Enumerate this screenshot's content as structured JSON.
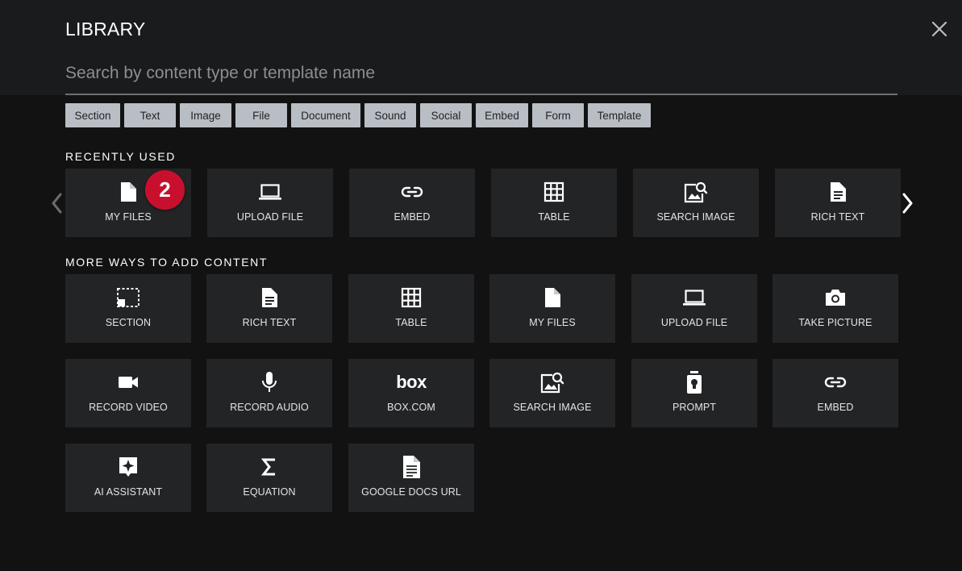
{
  "title": "LIBRARY",
  "search": {
    "placeholder": "Search by content type or template name"
  },
  "filters": [
    "Section",
    "Text",
    "Image",
    "File",
    "Document",
    "Sound",
    "Social",
    "Embed",
    "Form",
    "Template"
  ],
  "recently_used": {
    "label": "RECENTLY USED",
    "items": [
      {
        "label": "MY FILES",
        "icon": "file-icon"
      },
      {
        "label": "UPLOAD FILE",
        "icon": "laptop-icon"
      },
      {
        "label": "EMBED",
        "icon": "link-icon"
      },
      {
        "label": "TABLE",
        "icon": "table-icon"
      },
      {
        "label": "SEARCH IMAGE",
        "icon": "image-search-icon"
      },
      {
        "label": "RICH TEXT",
        "icon": "document-icon"
      }
    ]
  },
  "more_ways": {
    "label": "MORE WAYS TO ADD CONTENT",
    "items": [
      {
        "label": "SECTION",
        "icon": "section-icon"
      },
      {
        "label": "RICH TEXT",
        "icon": "document-icon"
      },
      {
        "label": "TABLE",
        "icon": "table-icon"
      },
      {
        "label": "MY FILES",
        "icon": "file-icon"
      },
      {
        "label": "UPLOAD FILE",
        "icon": "laptop-icon"
      },
      {
        "label": "TAKE PICTURE",
        "icon": "camera-icon"
      },
      {
        "label": "RECORD VIDEO",
        "icon": "video-camera-icon"
      },
      {
        "label": "RECORD AUDIO",
        "icon": "microphone-icon"
      },
      {
        "label": "BOX.COM",
        "icon": "box-logo-icon",
        "logo_text": "box"
      },
      {
        "label": "SEARCH IMAGE",
        "icon": "image-search-icon"
      },
      {
        "label": "PROMPT",
        "icon": "prompt-icon"
      },
      {
        "label": "EMBED",
        "icon": "link-icon"
      },
      {
        "label": "AI ASSISTANT",
        "icon": "ai-sparkle-icon"
      },
      {
        "label": "EQUATION",
        "icon": "sigma-icon"
      },
      {
        "label": "GOOGLE DOCS URL",
        "icon": "google-doc-icon"
      }
    ]
  },
  "badge": {
    "value": "2"
  },
  "colors": {
    "accent_badge": "#c8102e",
    "tile_bg": "#232426",
    "chip_bg": "#b9bec5"
  }
}
